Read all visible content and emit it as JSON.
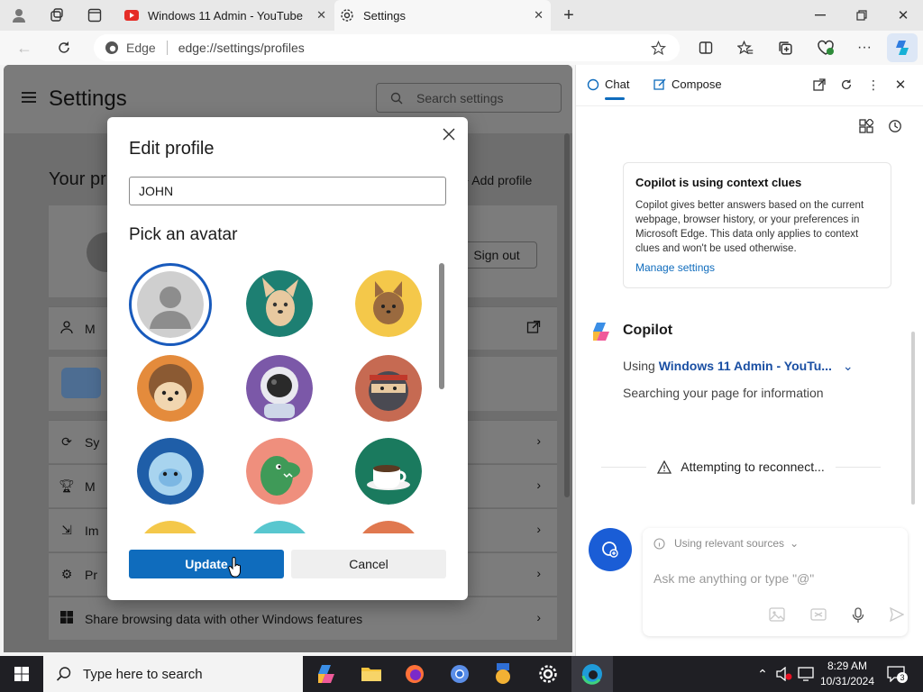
{
  "browser": {
    "tabs": [
      {
        "title": "Windows 11 Admin - YouTube"
      },
      {
        "title": "Settings"
      }
    ],
    "omnibox": {
      "site_label": "Edge",
      "url": "edge://settings/profiles"
    }
  },
  "settings": {
    "title": "Settings",
    "search_placeholder": "Search settings",
    "section_title": "Your pr",
    "add_profile_label": "Add profile",
    "sign_out_label": "Sign out",
    "rows": [
      {
        "label": "M"
      },
      {
        "label": "Sy"
      },
      {
        "label": "M"
      },
      {
        "label": "Im"
      },
      {
        "label": "Pr"
      },
      {
        "label": "Share browsing data with other Windows features"
      }
    ]
  },
  "modal": {
    "title": "Edit profile",
    "name_value": "JOHN",
    "pick_label": "Pick an avatar",
    "update_label": "Update",
    "cancel_label": "Cancel",
    "avatars": [
      "default-person",
      "dog",
      "cat",
      "hedgehog",
      "astronaut",
      "ninja",
      "yeti",
      "dinosaur",
      "coffee-cup"
    ],
    "selected_avatar": "default-person"
  },
  "copilot": {
    "tabs": [
      {
        "label": "Chat"
      },
      {
        "label": "Compose"
      }
    ],
    "context_card": {
      "heading": "Copilot is using context clues",
      "body": "Copilot gives better answers based on the current webpage, browser history, or your preferences in Microsoft Edge. This data only applies to context clues and won't be used otherwise.",
      "link": "Manage settings"
    },
    "name": "Copilot",
    "using_prefix": "Using",
    "using_source": "Windows 11 Admin - YouTu...",
    "searching": "Searching your page for information",
    "reconnect": "Attempting to reconnect...",
    "sources_label": "Using relevant sources",
    "ask_placeholder": "Ask me anything or type \"@\""
  },
  "taskbar": {
    "search_placeholder": "Type here to search",
    "time": "8:29 AM",
    "date": "10/31/2024",
    "notification_count": "3"
  },
  "colors": {
    "accent": "#0f6cbd",
    "taskbar": "#1f1f24",
    "link": "#1a4fa3"
  }
}
